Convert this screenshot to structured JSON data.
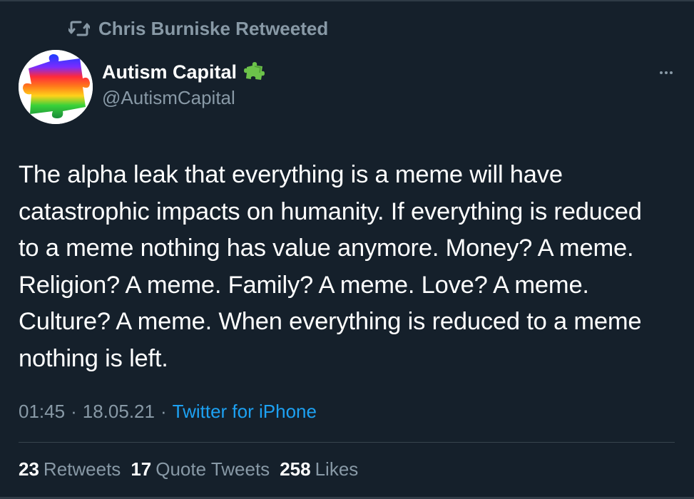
{
  "retweet_banner": {
    "text": "Chris Burniske Retweeted",
    "icon": "retweet-icon"
  },
  "author": {
    "name": "Autism Capital",
    "handle": "@AutismCapital",
    "badge_icon": "puzzle-piece-icon",
    "badge_color": "#6cc24a"
  },
  "tweet": {
    "text": "The alpha leak that everything is a meme will have\ncatastrophic impacts on humanity. If everything is reduced\nto a meme nothing has value anymore. Money? A meme.\nReligion? A meme. Family? A meme. Love? A meme.\nCulture? A meme. When everything is reduced to a meme\nnothing is left."
  },
  "meta": {
    "time": "01:45",
    "separator": "·",
    "date": "18.05.21",
    "source": "Twitter for iPhone"
  },
  "stats": {
    "retweets_count": "23",
    "retweets_label": "Retweets",
    "quotes_count": "17",
    "quotes_label": "Quote Tweets",
    "likes_count": "258",
    "likes_label": "Likes"
  },
  "colors": {
    "background": "#15202b",
    "secondary_text": "#8899a6",
    "link": "#1da1f2",
    "divider": "#38444d"
  }
}
